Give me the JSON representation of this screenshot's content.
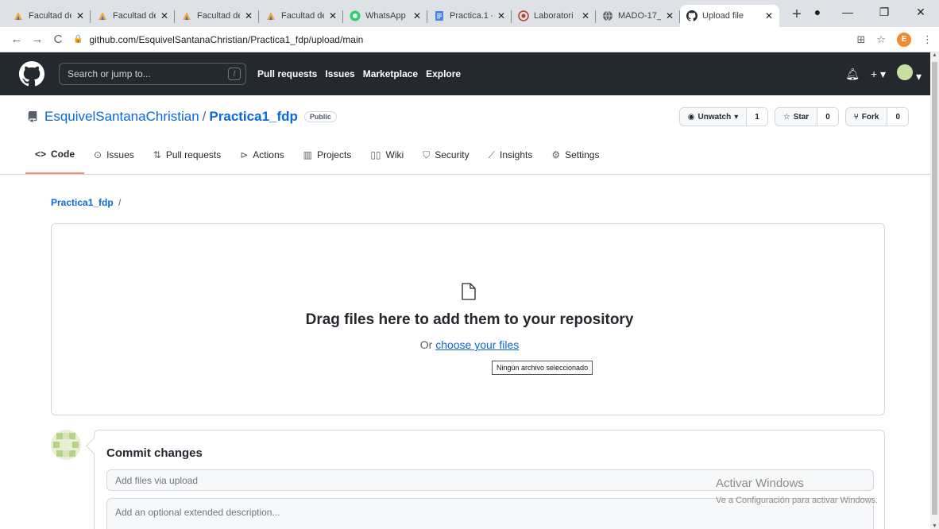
{
  "browser": {
    "tabs": [
      {
        "title": "Facultad de",
        "favicon": "unam-icon",
        "active": false
      },
      {
        "title": "Facultad de",
        "favicon": "unam-icon",
        "active": false
      },
      {
        "title": "Facultad de",
        "favicon": "unam-icon",
        "active": false
      },
      {
        "title": "Facultad de",
        "favicon": "unam-icon",
        "active": false
      },
      {
        "title": "WhatsApp",
        "favicon": "whatsapp-icon",
        "active": false
      },
      {
        "title": "Practica.1 -",
        "favicon": "docs-icon",
        "active": false
      },
      {
        "title": "Laboratori",
        "favicon": "lab-icon",
        "active": false
      },
      {
        "title": "MADO-17_",
        "favicon": "globe-icon",
        "active": false
      },
      {
        "title": "Upload file",
        "favicon": "github-icon",
        "active": true
      }
    ],
    "new_tab": "+",
    "url": "github.com/EsquivelSantanaChristian/Practica1_fdp/upload/main",
    "profile_initial": "E"
  },
  "header": {
    "search_placeholder": "Search or jump to...",
    "search_key": "/",
    "nav": [
      "Pull requests",
      "Issues",
      "Marketplace",
      "Explore"
    ]
  },
  "repo": {
    "owner": "EsquivelSantanaChristian",
    "separator": "/",
    "name": "Practica1_fdp",
    "visibility": "Public",
    "watch_label": "Unwatch",
    "watch_count": "1",
    "star_label": "Star",
    "star_count": "0",
    "fork_label": "Fork",
    "fork_count": "0",
    "tabs": [
      "Code",
      "Issues",
      "Pull requests",
      "Actions",
      "Projects",
      "Wiki",
      "Security",
      "Insights",
      "Settings"
    ]
  },
  "upload": {
    "breadcrumb_repo": "Practica1_fdp",
    "breadcrumb_sep": "/",
    "drag_text": "Drag files here to add them to your repository",
    "or_text": "Or",
    "choose_link": "choose your files",
    "tooltip": "Ningún archivo seleccionado"
  },
  "commit": {
    "heading": "Commit changes",
    "summary_placeholder": "Add files via upload",
    "description_placeholder": "Add an optional extended description..."
  },
  "watermark": {
    "line1": "Activar Windows",
    "line2": "Ve a Configuración para activar Windows."
  },
  "colors": {
    "accent": "#0969da",
    "header_bg": "#24292f",
    "active_tab_underline": "#fd8c73"
  }
}
